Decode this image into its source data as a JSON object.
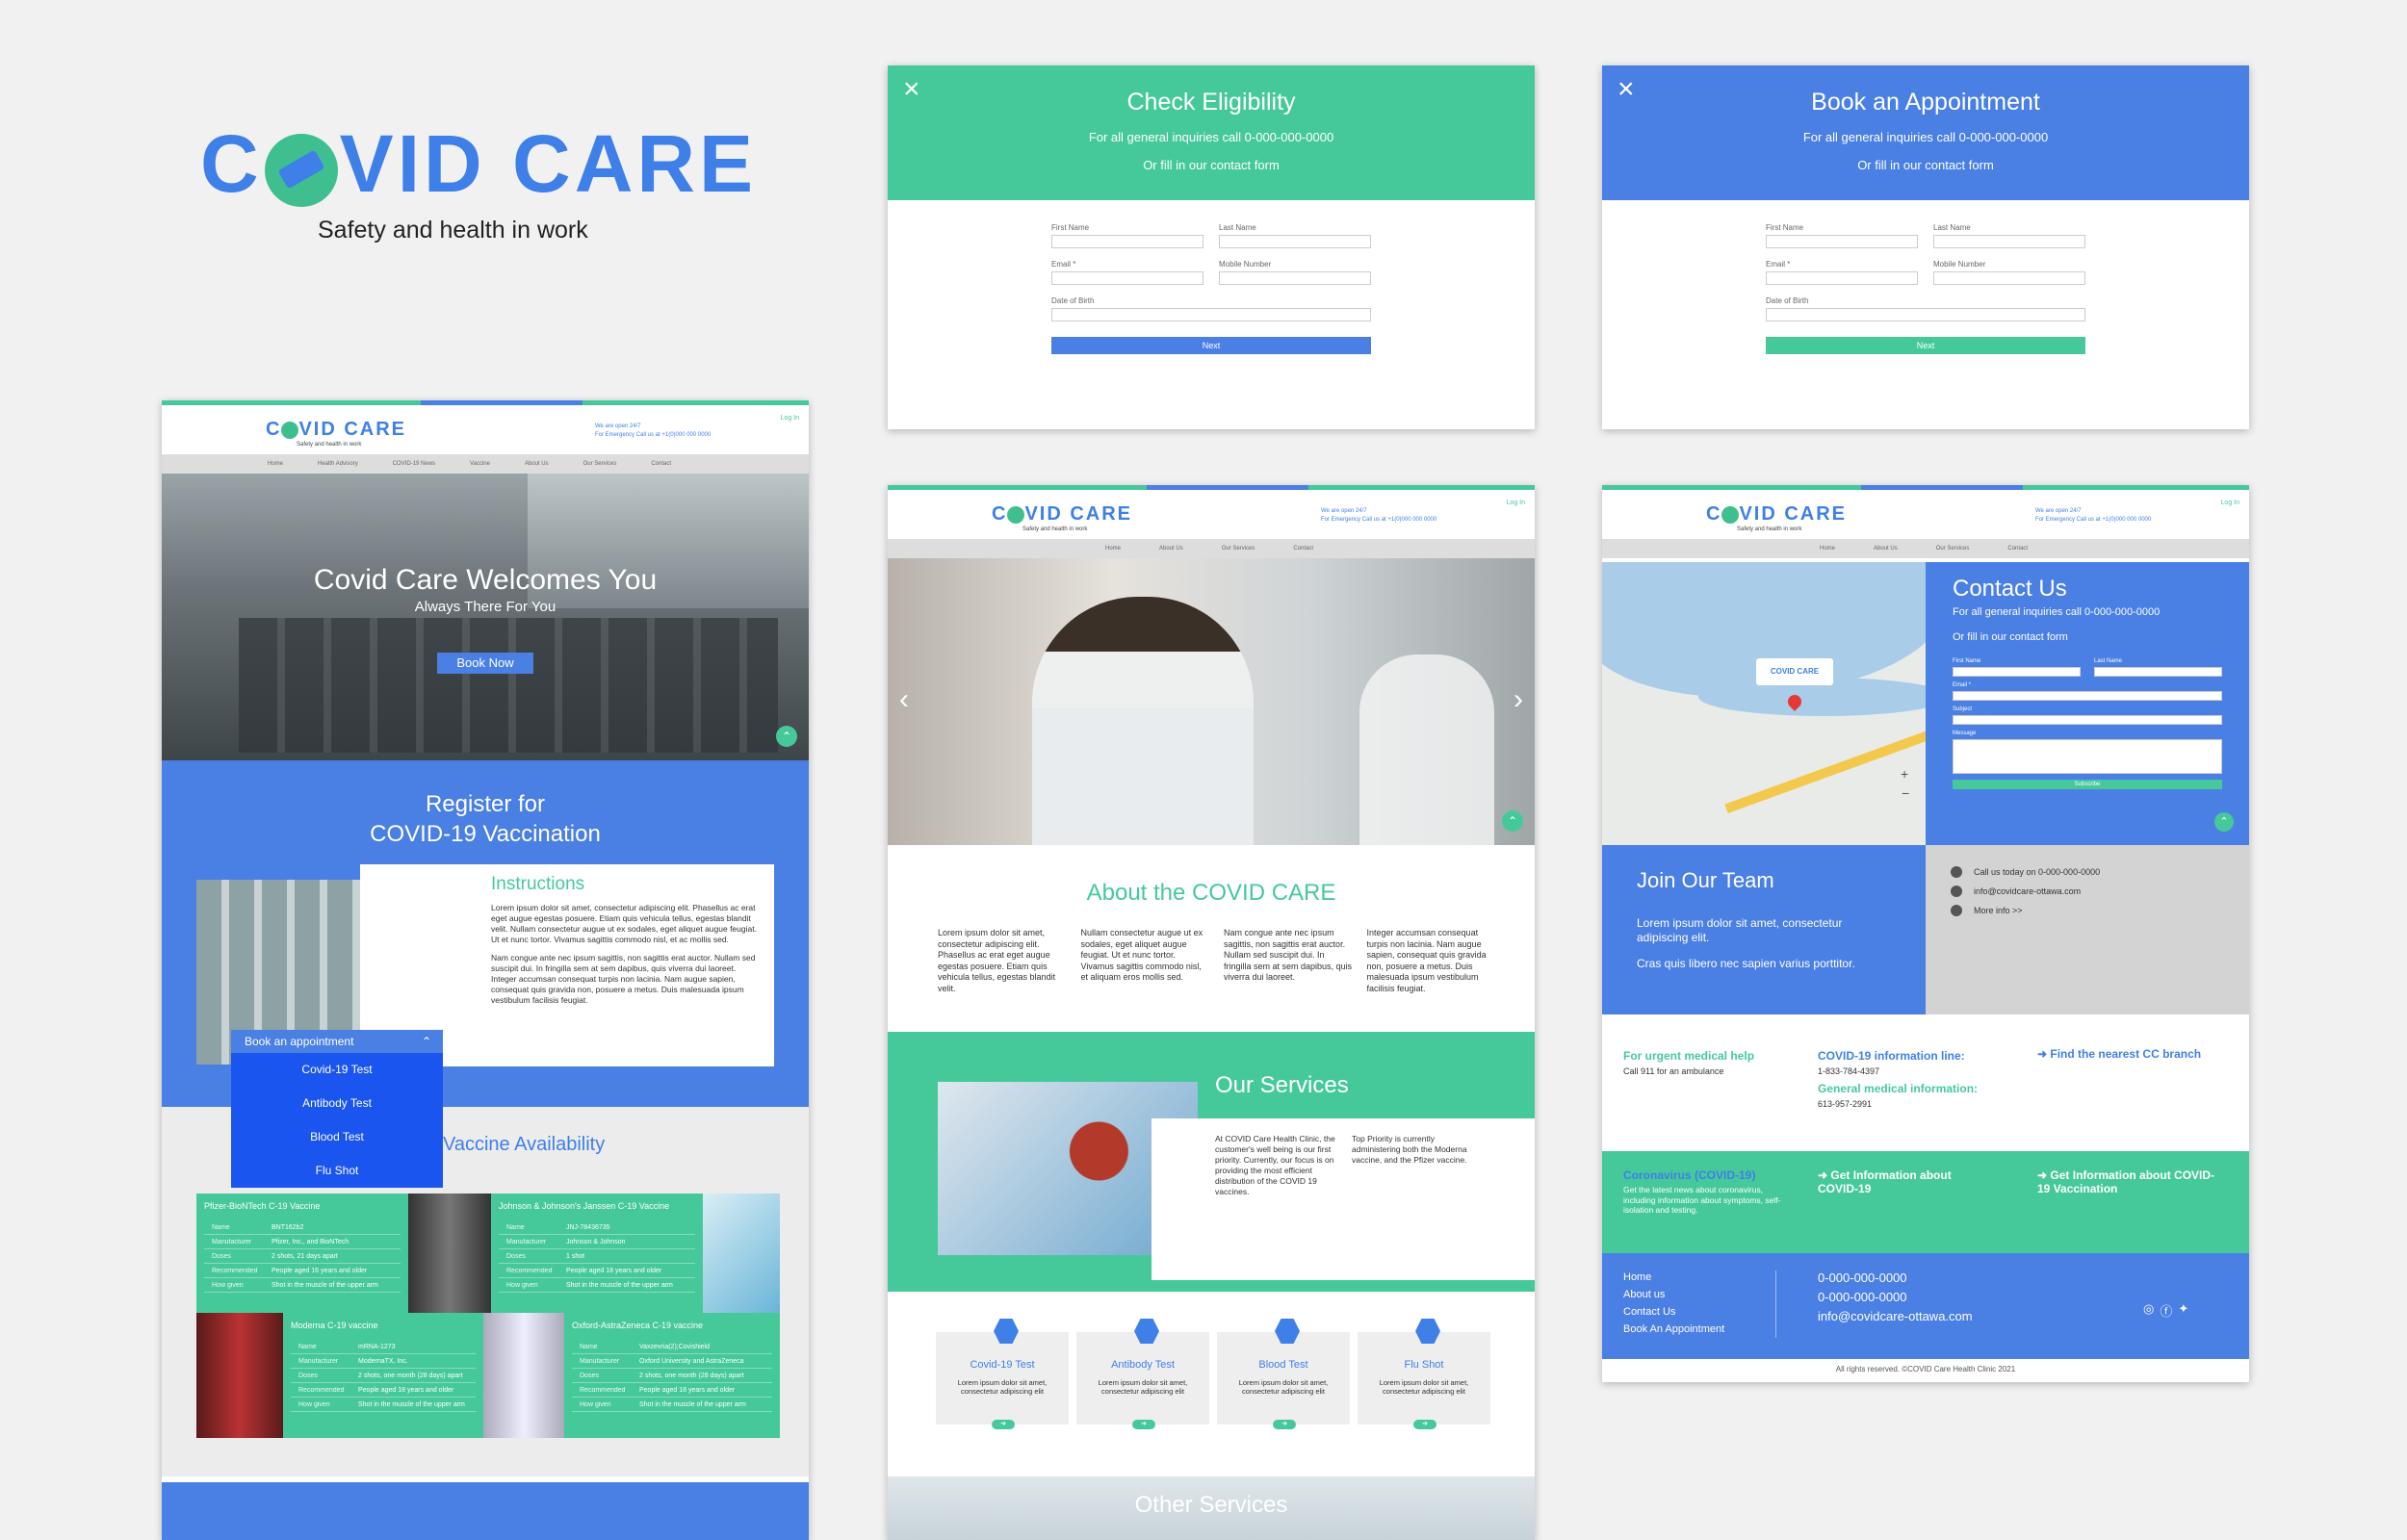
{
  "brand": {
    "title": "COVID CARE",
    "part1": "C",
    "part2": "VID CARE",
    "tagline": "Safety and health in work",
    "accent_blue": "#4a7fe3",
    "accent_green": "#46c99a"
  },
  "shared_header": {
    "logo_part1": "C",
    "logo_part2": "VID CARE",
    "tagline": "Safety and health in work",
    "call1": "We are open 24/7",
    "call2": "For Emergency Call us at +1(0)000 000 0000",
    "login": "Log In"
  },
  "modal_green": {
    "close": "×",
    "title": "Check Eligibility",
    "line1": "For all general inquiries call 0-000-000-0000",
    "line2": "Or fill in our contact form",
    "first": "First Name",
    "last": "Last Name",
    "email": "Email *",
    "mobile": "Mobile Number",
    "dob": "Date of Birth",
    "next": "Next"
  },
  "modal_blue": {
    "close": "×",
    "title": "Book an Appointment",
    "line1": "For all general inquiries call 0-000-000-0000",
    "line2": "Or fill in our contact form",
    "first": "First Name",
    "last": "Last Name",
    "email": "Email *",
    "mobile": "Mobile Number",
    "dob": "Date of Birth",
    "next": "Next"
  },
  "home": {
    "nav": [
      "Home",
      "Health Advisory",
      "COVID-19 News",
      "Vaccine",
      "About Us",
      "Our Services",
      "Contact"
    ],
    "hero_title": "Covid Care Welcomes You",
    "hero_sub": "Always There For You",
    "hero_btn": "Book Now",
    "register_line1": "Register for",
    "register_line2": "COVID-19 Vaccination",
    "instructions_title": "Instructions",
    "instructions_p1": "Lorem ipsum dolor sit amet, consectetur adipiscing elit. Phasellus ac erat eget augue egestas posuere. Etiam quis vehicula tellus, egestas blandit velit. Nullam consectetur augue ut ex sodales, eget aliquet augue feugiat. Ut et nunc tortor. Vivamus sagittis commodo nisl, et ac mollis sed.",
    "instructions_p2": "Nam congue ante nec ipsum sagittis, non sagittis erat auctor. Nullam sed suscipit dui. In fringilla sem at sem dapibus, quis viverra dui laoreet. Integer accumsan consequat turpis non lacinia. Nam augue sapien, consequat quis gravida non, posuere a metus. Duis malesuada ipsum vestibulum facilisis feugiat.",
    "dropdown_label": "Book an appointment",
    "dropdown_items": [
      "Covid-19 Test",
      "Antibody Test",
      "Blood Test",
      "Flu Shot"
    ],
    "vaccine_title": "Vaccine Availability",
    "vaccines": [
      {
        "name": "Pfizer-BioNTech C-19 Vaccine",
        "rows": [
          [
            "Name",
            "BNT162b2"
          ],
          [
            "Manufacturer",
            "Pfizer, Inc., and BioNTech"
          ],
          [
            "Doses",
            "2 shots, 21 days apart"
          ],
          [
            "Recommended",
            "People aged 16 years and older"
          ],
          [
            "How given",
            "Shot in the muscle of the upper arm"
          ]
        ]
      },
      {
        "name": "Johnson & Johnson's Janssen C-19 Vaccine",
        "rows": [
          [
            "Name",
            "JNJ-78436735"
          ],
          [
            "Manufacturer",
            "Johnson & Johnson"
          ],
          [
            "Doses",
            "1 shot"
          ],
          [
            "Recommended",
            "People aged 18 years and older"
          ],
          [
            "How given",
            "Shot in the muscle of the upper arm"
          ]
        ]
      },
      {
        "name": "Moderna C-19 vaccine",
        "rows": [
          [
            "Name",
            "mRNA-1273"
          ],
          [
            "Manufacturer",
            "ModernaTX, Inc."
          ],
          [
            "Doses",
            "2 shots, one month (28 days) apart"
          ],
          [
            "Recommended",
            "People aged 18 years and older"
          ],
          [
            "How given",
            "Shot in the muscle of the upper arm"
          ]
        ]
      },
      {
        "name": "Oxford-AstraZeneca C-19 vaccine",
        "rows": [
          [
            "Name",
            "Vaxzevria(2);Covishield"
          ],
          [
            "Manufacturer",
            "Oxford University and AstraZeneca"
          ],
          [
            "Doses",
            "2 shots, one month (28 days) apart"
          ],
          [
            "Recommended",
            "People aged 18 years and older"
          ],
          [
            "How given",
            "Shot in the muscle of the upper arm"
          ]
        ]
      }
    ]
  },
  "about": {
    "nav": [
      "Home",
      "About Us",
      "Our Services",
      "Contact"
    ],
    "title": "About the COVID CARE",
    "cols": [
      "Lorem ipsum dolor sit amet, consectetur adipiscing elit. Phasellus ac erat eget augue egestas posuere. Etiam quis vehicula tellus, egestas blandit velit.",
      "Nullam consectetur augue ut ex sodales, eget aliquet augue feugiat. Ut et nunc tortor. Vivamus sagittis commodo nisl, et aliquam eros mollis sed.",
      "Nam congue ante nec ipsum sagittis, non sagittis erat auctor. Nullam sed suscipit dui. In fringilla sem at sem dapibus, quis viverra dui laoreet.",
      "Integer accumsan consequat turpis non lacinia. Nam augue sapien, consequat quis gravida non, posuere a metus. Duis malesuada ipsum vestibulum facilisis feugiat."
    ],
    "services_title": "Our Services",
    "services_p1": "At COVID Care Health Clinic, the customer's well being is our first priority. Currently, our focus is on providing the most efficient distribution of the COVID 19 vaccines.",
    "services_p2": "Top Priority is currently administering both the Moderna vaccine, and the Pfizer vaccine.",
    "cards": [
      {
        "title": "Covid-19 Test",
        "desc": "Lorem ipsum dolor sit amet, consectetur adipiscing elit"
      },
      {
        "title": "Antibody Test",
        "desc": "Lorem ipsum dolor sit amet, consectetur adipiscing elit"
      },
      {
        "title": "Blood Test",
        "desc": "Lorem ipsum dolor sit amet, consectetur adipiscing elit"
      },
      {
        "title": "Flu Shot",
        "desc": "Lorem ipsum dolor sit amet, consectetur adipiscing elit"
      }
    ],
    "other_title": "Other Services"
  },
  "contact": {
    "nav": [
      "Home",
      "About Us",
      "Our Services",
      "Contact"
    ],
    "map_logo": "COVID CARE",
    "title": "Contact Us",
    "line1": "For all general inquiries call  0-000-000-0000",
    "line2": "Or fill in our contact form",
    "first": "First Name",
    "last": "Last Name",
    "email": "Email *",
    "subject": "Subject",
    "message": "Message",
    "submit": "Subscribe",
    "join_title": "Join Our Team",
    "join_p1": "Lorem ipsum dolor sit amet, consectetur adipiscing elit.",
    "join_p2": "Cras quis libero nec sapien varius porttitor.",
    "info": [
      "Call us today on 0-000-000-0000",
      "info@covidcare-ottawa.com",
      "More info >>"
    ],
    "urgent_title": "For urgent medical help",
    "urgent_sub": "Call 911 for an ambulance",
    "covid_line_title": "COVID-19 information line:",
    "covid_line_num": "1-833-784-4397",
    "general_title": "General medical information:",
    "general_num": "613-957-2991",
    "nearest": "Find the nearest CC  branch",
    "corona_title": "Coronavirus (COVID-19)",
    "corona_desc": "Get the latest news about coronavirus, including information about symptoms, self-isolation and testing.",
    "get_info1": "Get Information about COVID-19",
    "get_info2": "Get Information about COVID-19 Vaccination",
    "footer_links": [
      "Home",
      "About us",
      "Contact Us",
      "Book An Appointment"
    ],
    "footer_contact": [
      "0-000-000-0000",
      "0-000-000-0000",
      "info@covidcare-ottawa.com"
    ],
    "copyright": "All rights reserved. ©COVID Care Health Clinic 2021"
  }
}
